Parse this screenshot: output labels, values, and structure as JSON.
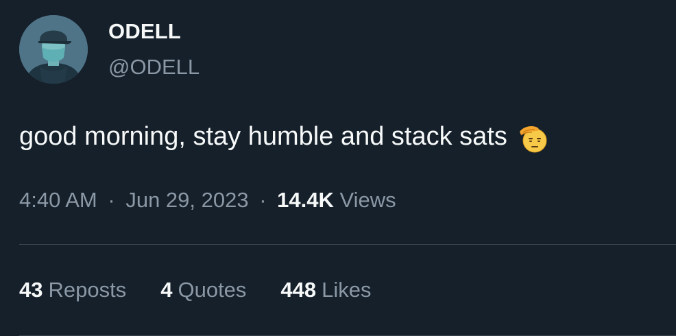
{
  "author": {
    "display_name": "ODELL",
    "handle": "@ODELL",
    "avatar_icon": "masked-man-avatar"
  },
  "tweet": {
    "text": "good morning, stay humble and stack sats",
    "emoji": "saluting-face-emoji"
  },
  "meta": {
    "time": "4:40 AM",
    "date": "Jun 29, 2023",
    "separator": "·",
    "views_count": "14.4K",
    "views_label": "Views"
  },
  "stats": {
    "reposts_count": "43",
    "reposts_label": "Reposts",
    "quotes_count": "4",
    "quotes_label": "Quotes",
    "likes_count": "448",
    "likes_label": "Likes"
  },
  "colors": {
    "background": "#15202b",
    "primary_text": "#f7f9f9",
    "secondary_text": "#8b98a5",
    "divider": "#38444d"
  }
}
